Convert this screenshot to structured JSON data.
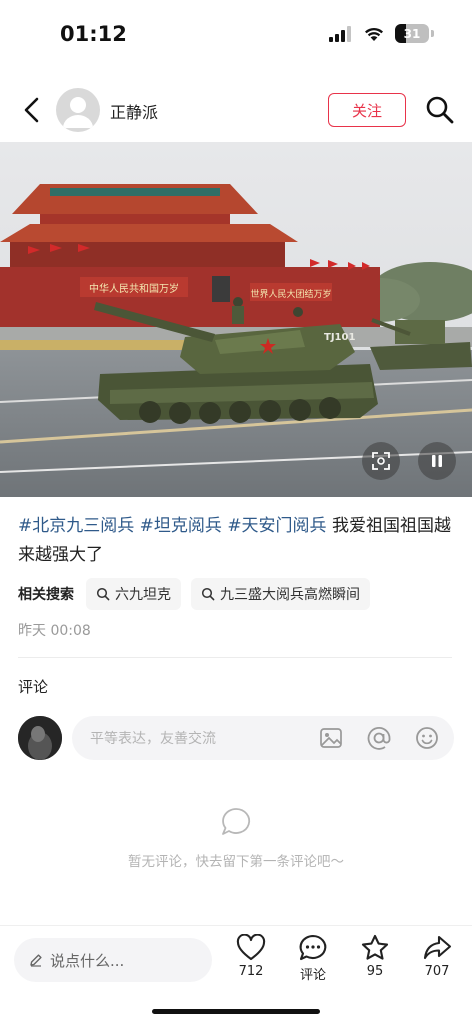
{
  "status_bar": {
    "time": "01:12",
    "battery": "31",
    "battery_level": 0.31
  },
  "header": {
    "author_name": "正静派",
    "follow_label": "关注"
  },
  "media": {
    "gate_banner_left": "中华人民共和国万岁",
    "gate_banner_right": "世界人民大团结万岁",
    "tank_number": "TJ101"
  },
  "caption": {
    "tags": [
      "#北京九三阅兵",
      "#坦克阅兵",
      "#天安门阅兵"
    ],
    "text": "我爱祖国祖国越来越强大了"
  },
  "related": {
    "label": "相关搜索",
    "items": [
      "六九坦克",
      "九三盛大阅兵高燃瞬间"
    ]
  },
  "post_time": "昨天 00:08",
  "comments": {
    "title": "评论",
    "input_placeholder": "平等表达，友善交流",
    "empty_text": "暂无评论，快去留下第一条评论吧～"
  },
  "bottom_bar": {
    "input_placeholder": "说点什么...",
    "likes": "712",
    "comment_label": "评论",
    "favorites": "95",
    "shares": "707"
  },
  "colors": {
    "accent": "#e8334a",
    "tag": "#2f5a8a",
    "muted": "#b4b4b4"
  }
}
